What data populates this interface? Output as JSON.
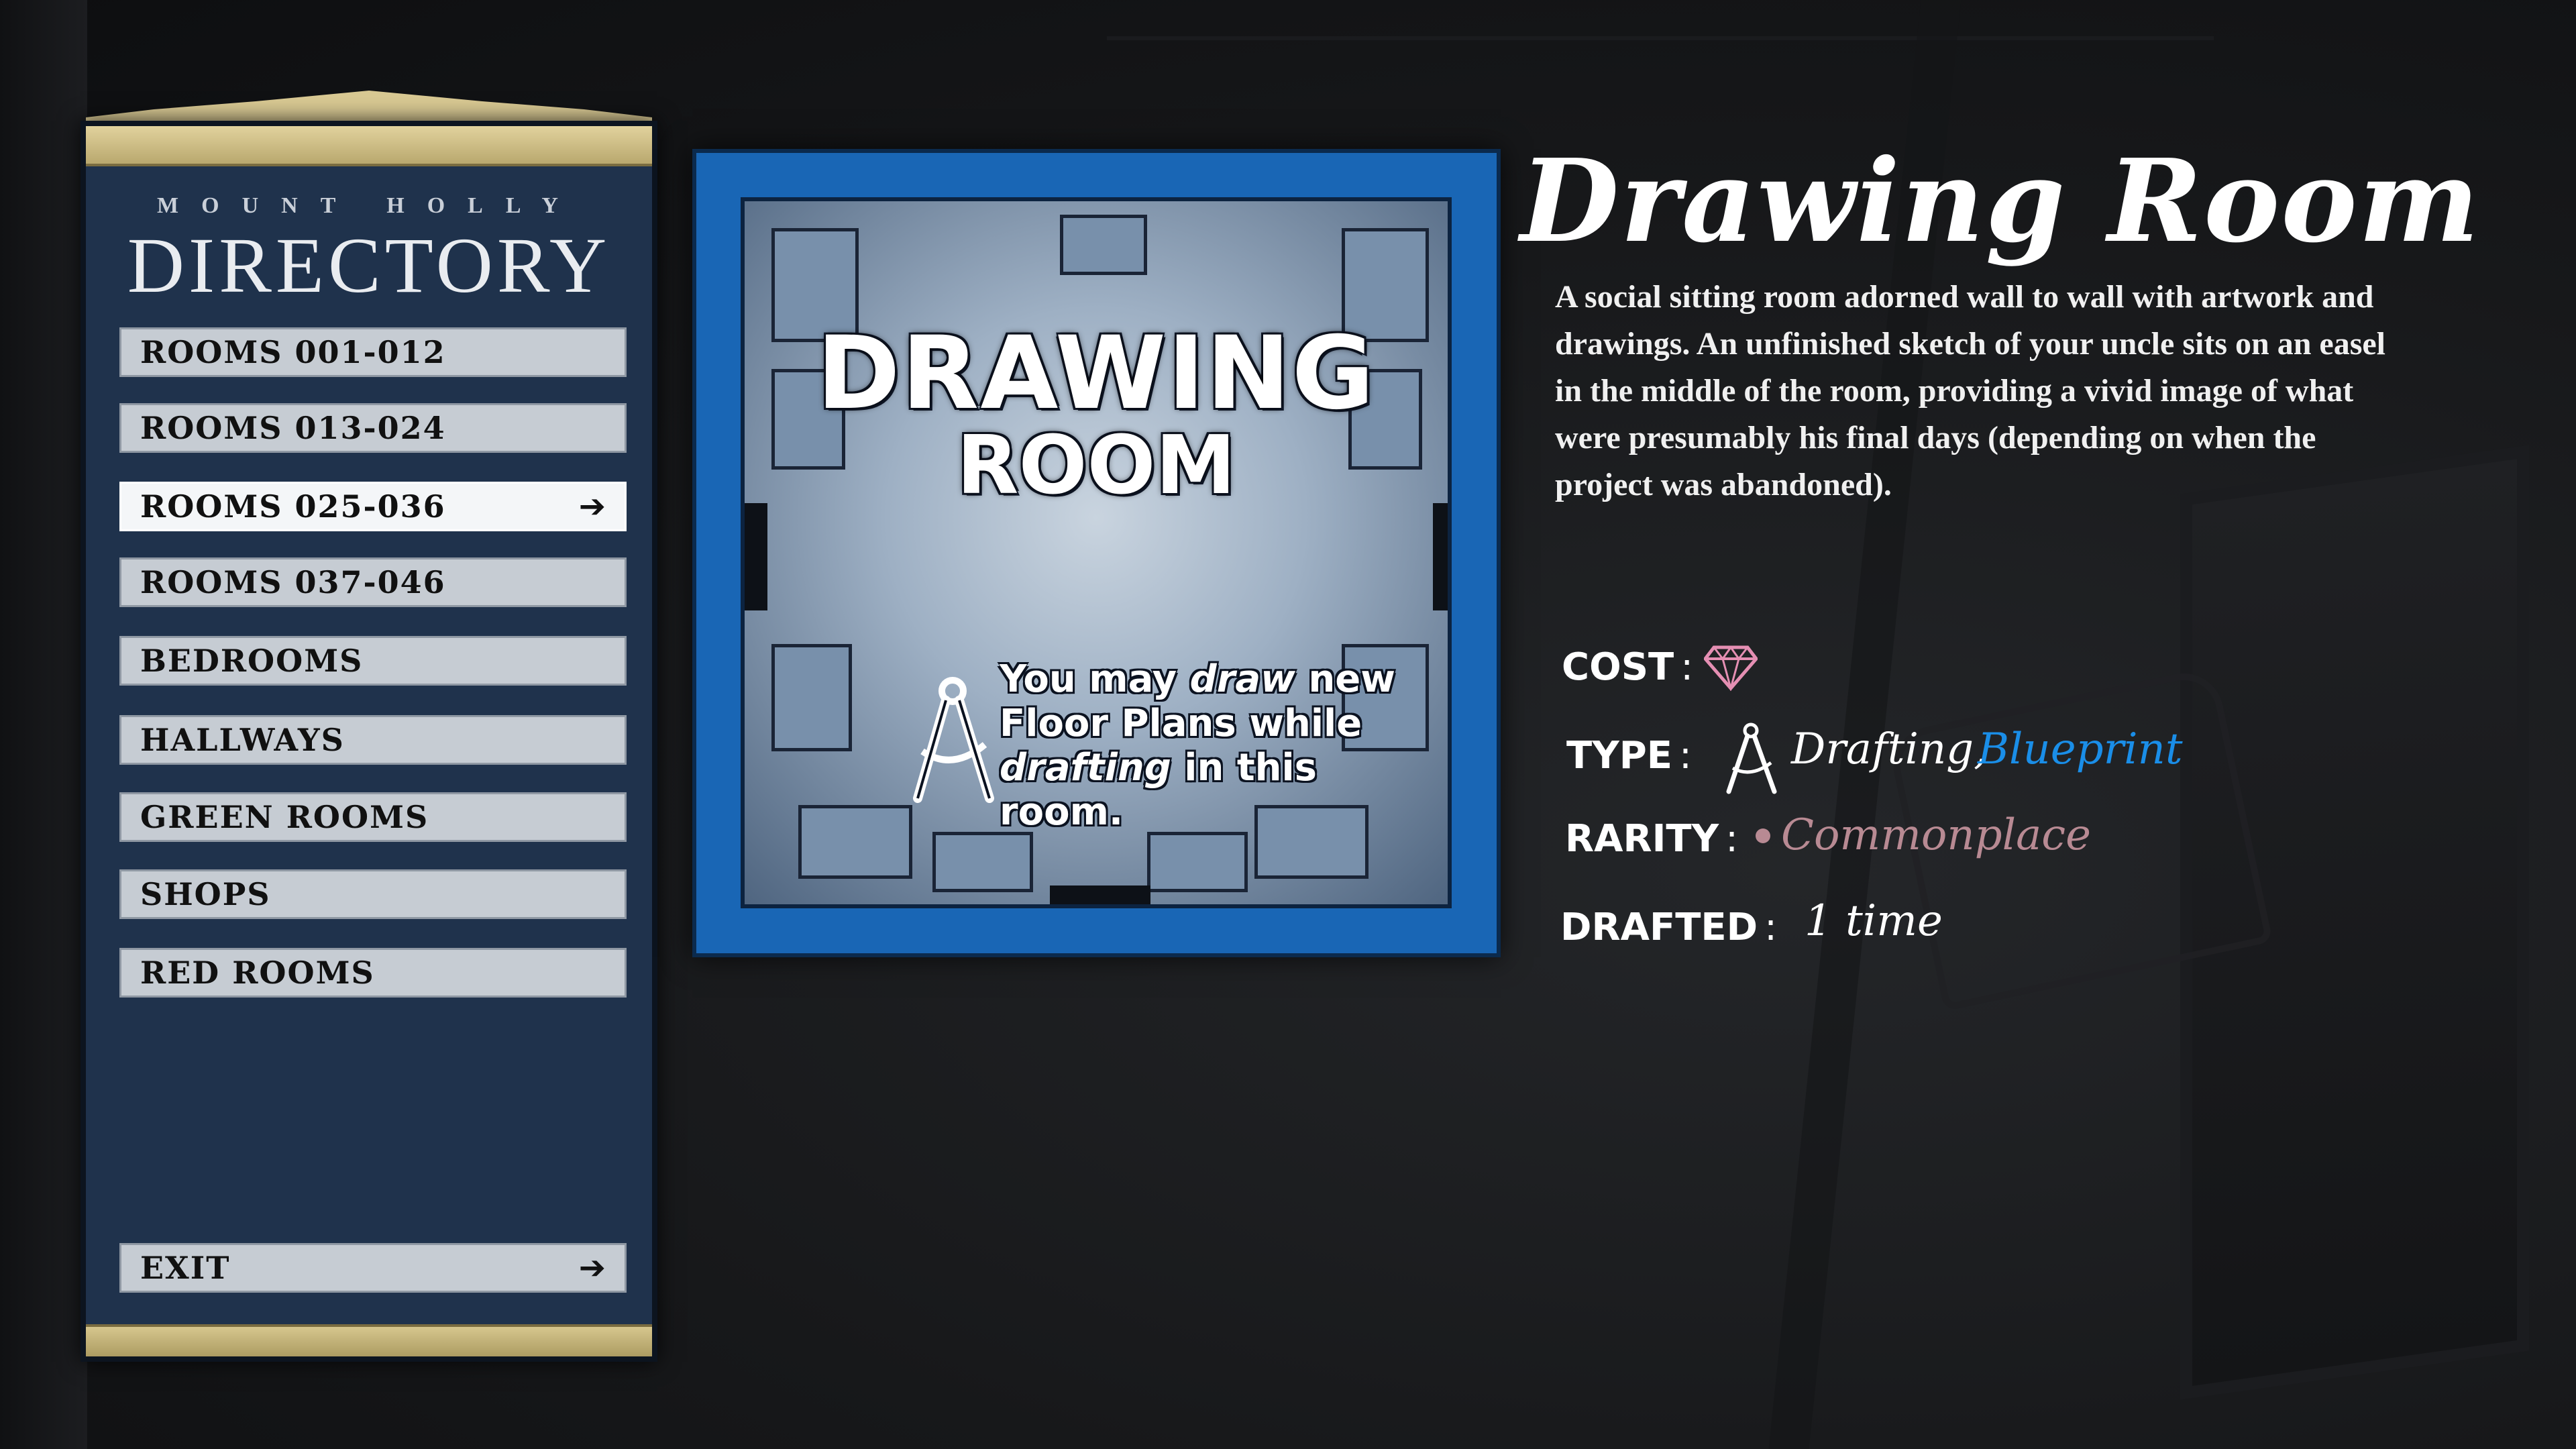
{
  "directory": {
    "subtitle": "MOUNT HOLLY",
    "title": "DIRECTORY",
    "items": [
      {
        "label": "ROOMS 001-012"
      },
      {
        "label": "ROOMS 013-024"
      },
      {
        "label": "ROOMS 025-036",
        "selected": true
      },
      {
        "label": "ROOMS 037-046"
      },
      {
        "label": "BEDROOMS"
      },
      {
        "label": "HALLWAYS"
      },
      {
        "label": "GREEN ROOMS"
      },
      {
        "label": "SHOPS"
      },
      {
        "label": "RED ROOMS"
      }
    ],
    "exit_label": "EXIT",
    "arrow_icon": "arrow-right-icon"
  },
  "card": {
    "title_line1": "DRAWING",
    "title_line2": "ROOM",
    "note_part1": "You may ",
    "note_italic1": "draw",
    "note_part2": " new Floor Plans while ",
    "note_italic2": "drafting",
    "note_part3": " in this room.",
    "icon": "compass-icon",
    "border_color": "#1966b5"
  },
  "room": {
    "name": "Drawing Room",
    "description": "A social sitting room adorned wall to wall with artwork and drawings. An unfinished sketch of your uncle sits on an easel in the middle of the room, providing a vivid image of what were presumably his final days (depending on when the project was abandoned).",
    "stats": {
      "cost_label": "COST",
      "cost_icon": "gem-icon",
      "type_label": "TYPE",
      "type_icon": "compass-icon",
      "type_value1": "Drafting,",
      "type_value2": "Blueprint",
      "rarity_label": "RARITY",
      "rarity_value": "Commonplace",
      "drafted_label": "DRAFTED",
      "drafted_value": "1 time"
    },
    "colors": {
      "blueprint_text": "#1a8ee8",
      "rarity_text": "#b88a93",
      "gem": "#e58fb3"
    }
  }
}
